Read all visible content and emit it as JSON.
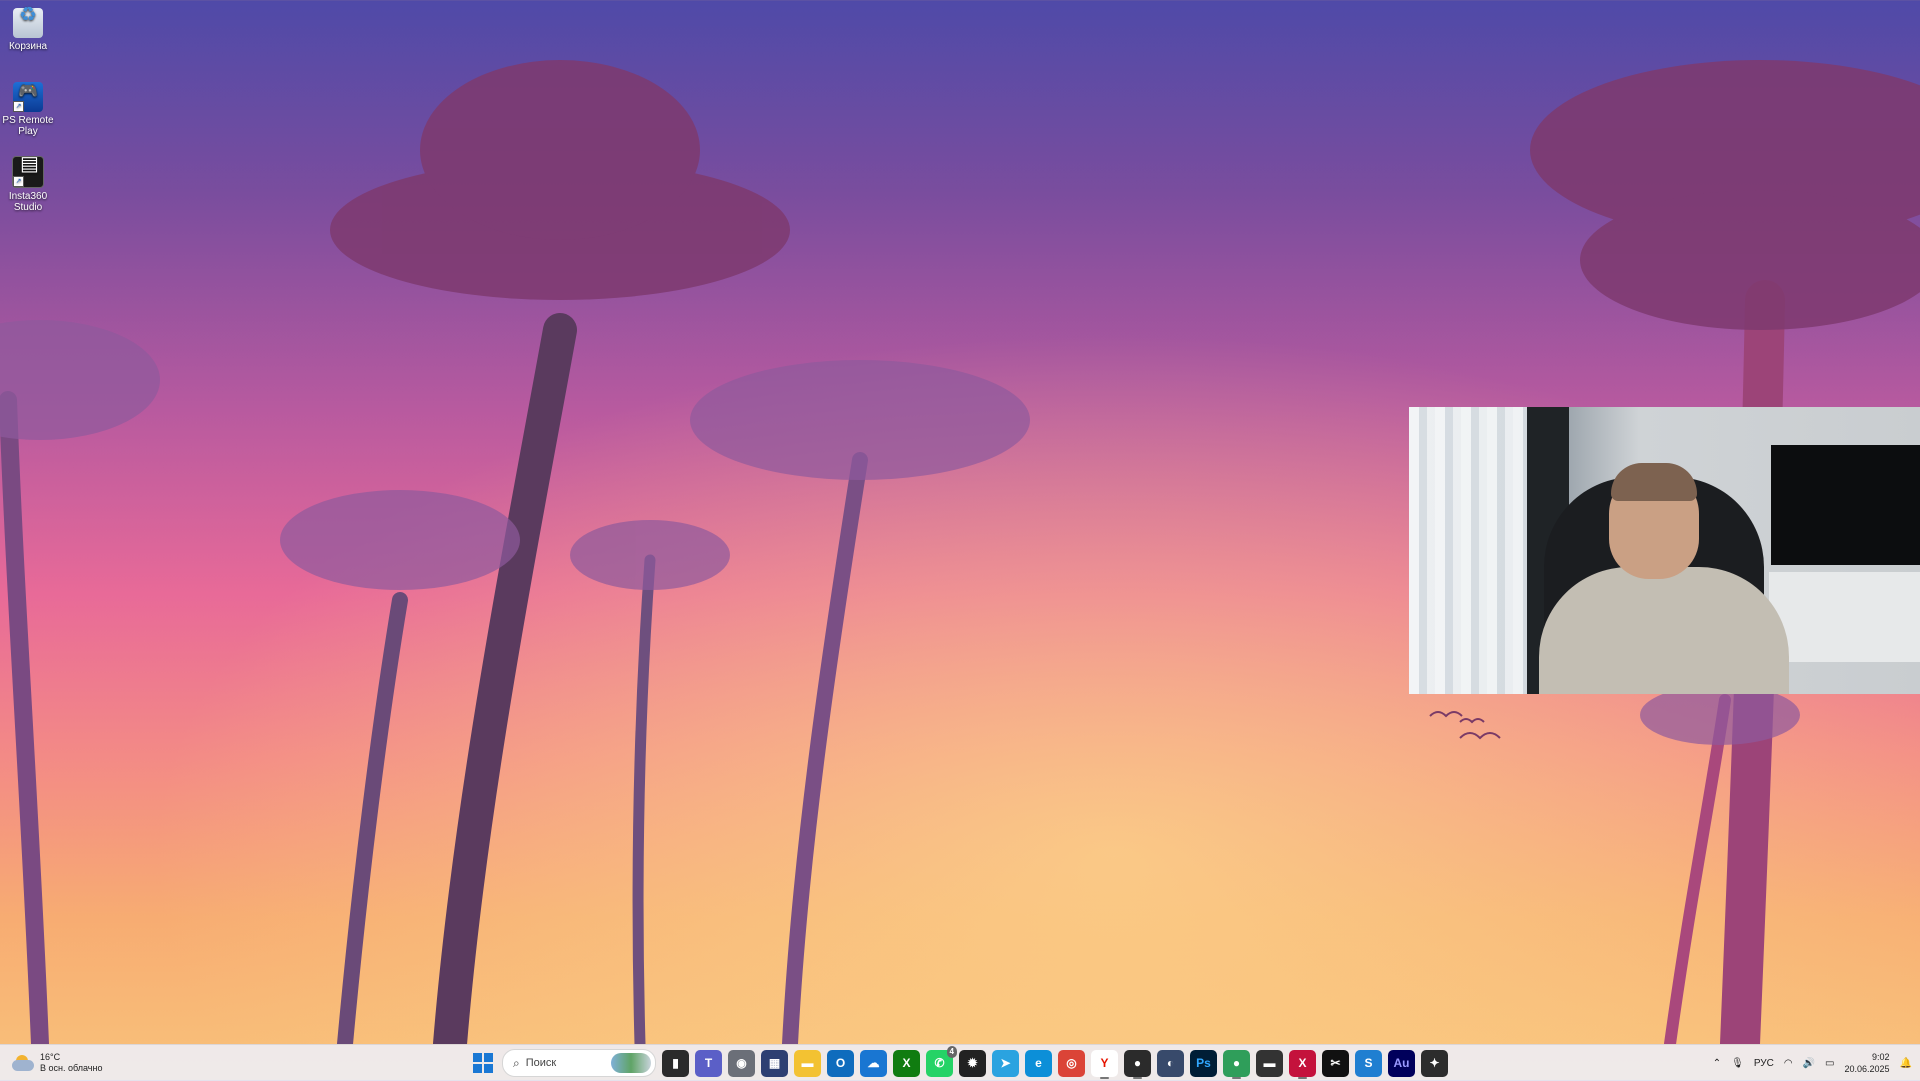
{
  "desktop": {
    "icons": [
      {
        "label": "Корзина",
        "icon": "recycle-bin-icon"
      },
      {
        "label": "PS Remote Play",
        "icon": "ps-remote-play-icon"
      },
      {
        "label": "Insta360 Studio",
        "icon": "insta360-studio-icon"
      }
    ]
  },
  "taskbar": {
    "weather": {
      "temp": "16°C",
      "condition": "В осн. облачно"
    },
    "search_placeholder": "Поиск",
    "apps": [
      {
        "name": "task-view",
        "glyph": "▮",
        "bg": "#2b2b2b"
      },
      {
        "name": "teams",
        "glyph": "T",
        "bg": "#5b5fc7"
      },
      {
        "name": "camera",
        "glyph": "◉",
        "bg": "#6b6f78"
      },
      {
        "name": "calculator",
        "glyph": "▦",
        "bg": "#2d3f72"
      },
      {
        "name": "file-explorer",
        "glyph": "▬",
        "bg": "#f3c232"
      },
      {
        "name": "outlook",
        "glyph": "O",
        "bg": "#0f6cbd"
      },
      {
        "name": "onedrive",
        "glyph": "☁",
        "bg": "#1976d2"
      },
      {
        "name": "xbox",
        "glyph": "X",
        "bg": "#107c10"
      },
      {
        "name": "whatsapp",
        "glyph": "✆",
        "bg": "#25d366",
        "badge": "4"
      },
      {
        "name": "photos-app",
        "glyph": "✹",
        "bg": "#222222"
      },
      {
        "name": "telegram",
        "glyph": "➤",
        "bg": "#2aa3e0"
      },
      {
        "name": "edge",
        "glyph": "e",
        "bg": "#0c8fd8"
      },
      {
        "name": "chrome",
        "glyph": "◎",
        "bg": "#db4437"
      },
      {
        "name": "yandex-browser",
        "glyph": "Y",
        "bg": "#ffffff",
        "fg": "#e61400"
      },
      {
        "name": "obs",
        "glyph": "●",
        "bg": "#2b2b2b"
      },
      {
        "name": "steam",
        "glyph": "◐",
        "bg": "#384a6b"
      },
      {
        "name": "photoshop",
        "glyph": "Ps",
        "bg": "#001e36",
        "fg": "#31a8ff"
      },
      {
        "name": "green-app",
        "glyph": "●",
        "bg": "#2f9e5a"
      },
      {
        "name": "mixer-app",
        "glyph": "▬",
        "bg": "#333333"
      },
      {
        "name": "x-app",
        "glyph": "X",
        "bg": "#c4123c"
      },
      {
        "name": "capcut",
        "glyph": "✂",
        "bg": "#111111"
      },
      {
        "name": "s-app",
        "glyph": "S",
        "bg": "#1f7fd1"
      },
      {
        "name": "audition",
        "glyph": "Au",
        "bg": "#00005b",
        "fg": "#9999ff"
      },
      {
        "name": "davinci-resolve",
        "glyph": "✦",
        "bg": "#2c2c2c"
      }
    ],
    "tray": {
      "language": "РУС",
      "time": "9:02",
      "date": "20.06.2025"
    }
  }
}
